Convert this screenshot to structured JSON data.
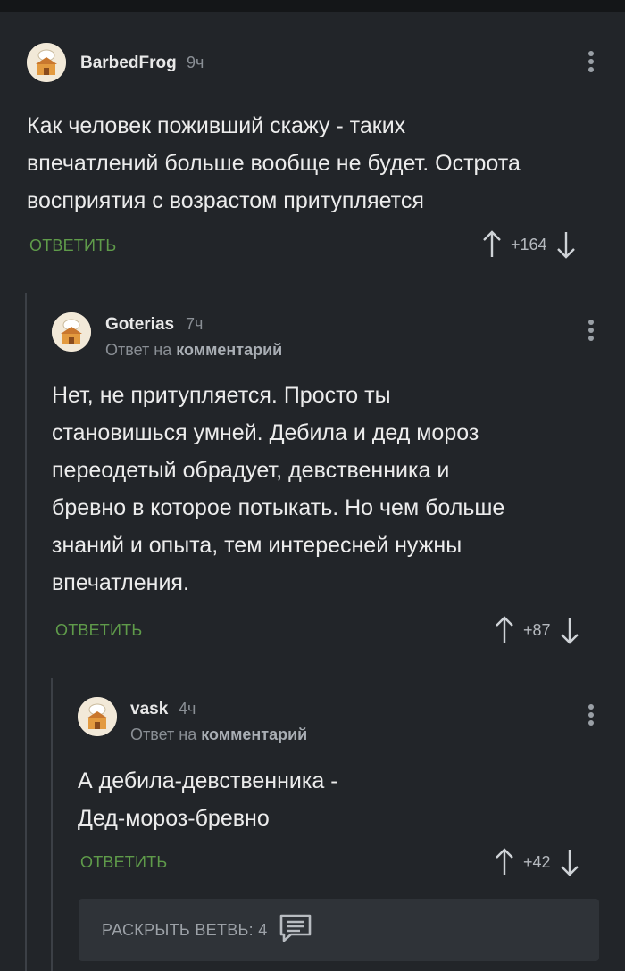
{
  "comments": [
    {
      "author": "BarbedFrog",
      "time": "9ч",
      "text_lines": [
        "Как человек поживший скажу - таких",
        "впечатлений больше вообще не будет. Острота",
        "восприятия с возрастом притупляется"
      ],
      "reply_label": "ОТВЕТИТЬ",
      "score": "+164"
    },
    {
      "author": "Goterias",
      "time": "7ч",
      "reply_to_prefix": "Ответ на",
      "reply_to_link": "комментарий",
      "text_lines": [
        "Нет, не притупляется. Просто ты",
        "становишься умней. Дебила и дед мороз",
        "переодетый обрадует, девственника и",
        "бревно в которое потыкать. Но чем больше",
        "знаний и опыта, тем интересней нужны",
        "впечатления."
      ],
      "reply_label": "ОТВЕТИТЬ",
      "score": "+87"
    },
    {
      "author": "vask",
      "time": "4ч",
      "reply_to_prefix": "Ответ на",
      "reply_to_link": "комментарий",
      "text_lines": [
        "А дебила-девственника -",
        "Дед-мороз-бревно"
      ],
      "reply_label": "ОТВЕТИТЬ",
      "score": "+42"
    }
  ],
  "expand": {
    "label": "РАСКРЫТЬ ВЕТВЬ: 4",
    "icon": "comments-icon"
  },
  "icons": {
    "avatar": "avatar-icon",
    "more": "more-vertical-icon",
    "upvote": "arrow-up-icon",
    "downvote": "arrow-down-icon"
  },
  "colors": {
    "background": "#222529",
    "reply": "#5f9b4a",
    "muted": "#8a8f95"
  }
}
